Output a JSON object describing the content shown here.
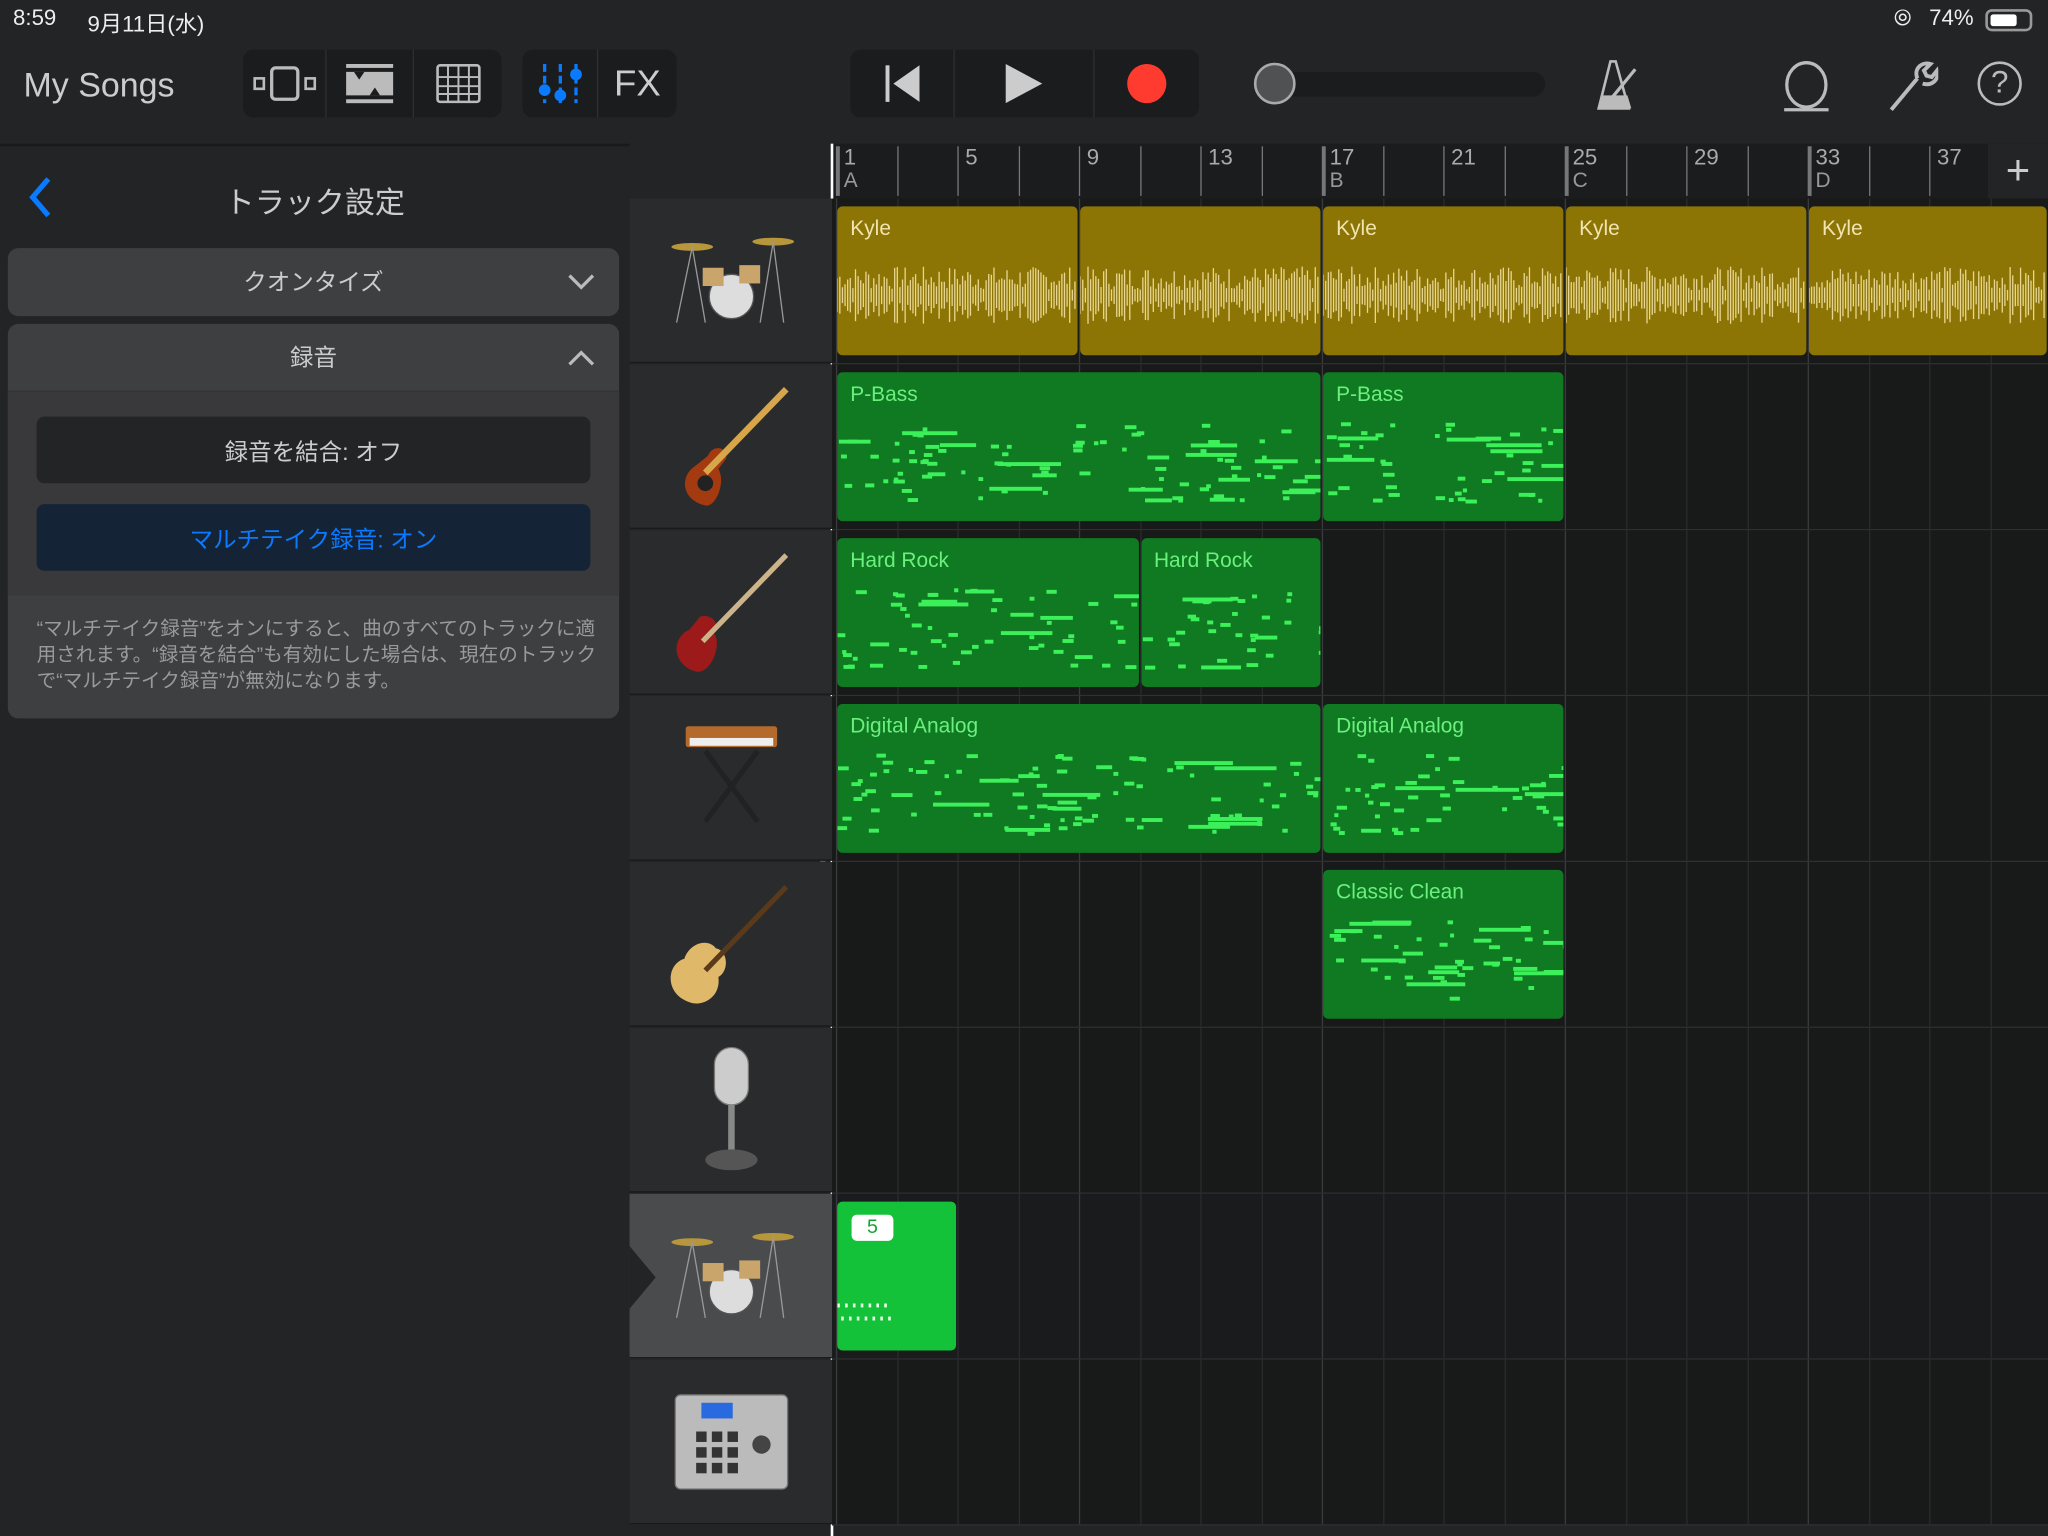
{
  "status": {
    "time": "8:59",
    "date": "9月11日(水)",
    "battery": "74%"
  },
  "toolbar": {
    "my_songs": "My Songs",
    "fx": "FX",
    "icons": [
      "tracks-view-icon",
      "live-loops-icon",
      "grid-icon",
      "mixer-icon"
    ],
    "transport": [
      "go-to-beginning-icon",
      "play-icon",
      "record-icon"
    ],
    "right_icons": [
      "metronome-icon",
      "loop-icon",
      "wrench-icon",
      "help-icon"
    ],
    "record_color": "#ff3b30",
    "accent": "#0a7aff"
  },
  "panel": {
    "title": "トラック設定",
    "quantize": "クオンタイズ",
    "recording": "録音",
    "merge": "録音を結合: オフ",
    "multitake": "マルチテイク録音: オン",
    "description": "“マルチテイク録音”をオンにすると、曲のすべてのトラックに適用されます。“録音を結合”も有効にした場合は、現在のトラックで“マルチテイク録音”が無効になります。"
  },
  "ruler": {
    "bars": [
      "1",
      "5",
      "9",
      "13",
      "17",
      "21",
      "25",
      "29",
      "33",
      "37"
    ],
    "sections": {
      "1": "A",
      "17": "B",
      "25": "C",
      "33": "D"
    }
  },
  "tracks": [
    {
      "instrument": "drum-kit-icon",
      "selected": false
    },
    {
      "instrument": "bass-guitar-icon",
      "selected": false
    },
    {
      "instrument": "electric-guitar-icon",
      "selected": false
    },
    {
      "instrument": "keyboard-icon",
      "selected": false
    },
    {
      "instrument": "hollow-body-guitar-icon",
      "selected": false
    },
    {
      "instrument": "microphone-icon",
      "selected": false
    },
    {
      "instrument": "drum-kit-icon",
      "selected": true
    },
    {
      "instrument": "beat-sequencer-icon",
      "selected": false
    }
  ],
  "regions": [
    {
      "track": 0,
      "name": "Kyle",
      "start": 1,
      "end": 9,
      "kind": "audio"
    },
    {
      "track": 0,
      "name": "",
      "start": 9,
      "end": 17,
      "kind": "audio"
    },
    {
      "track": 0,
      "name": "Kyle",
      "start": 17,
      "end": 25,
      "kind": "audio"
    },
    {
      "track": 0,
      "name": "Kyle",
      "start": 25,
      "end": 33,
      "kind": "audio"
    },
    {
      "track": 0,
      "name": "Kyle",
      "start": 33,
      "end": 41,
      "kind": "audio"
    },
    {
      "track": 1,
      "name": "P-Bass",
      "start": 1,
      "end": 17,
      "kind": "midi"
    },
    {
      "track": 1,
      "name": "P-Bass",
      "start": 17,
      "end": 25,
      "kind": "midi"
    },
    {
      "track": 2,
      "name": "Hard Rock",
      "start": 1,
      "end": 11,
      "kind": "midi"
    },
    {
      "track": 2,
      "name": "Hard Rock",
      "start": 11,
      "end": 17,
      "kind": "midi"
    },
    {
      "track": 3,
      "name": "Digital Analog",
      "start": 1,
      "end": 17,
      "kind": "midi"
    },
    {
      "track": 3,
      "name": "Digital Analog",
      "start": 17,
      "end": 25,
      "kind": "midi"
    },
    {
      "track": 4,
      "name": "Classic Clean",
      "start": 17,
      "end": 25,
      "kind": "midi"
    },
    {
      "track": 6,
      "name": "",
      "start": 1,
      "end": 5,
      "kind": "recording",
      "badge": "5"
    }
  ],
  "colors": {
    "audio": "#8c7505",
    "audio_wave": "#e8d690",
    "midi": "#0f7a22",
    "midi_notes": "#3cf05a",
    "recording": "#14c23a"
  }
}
